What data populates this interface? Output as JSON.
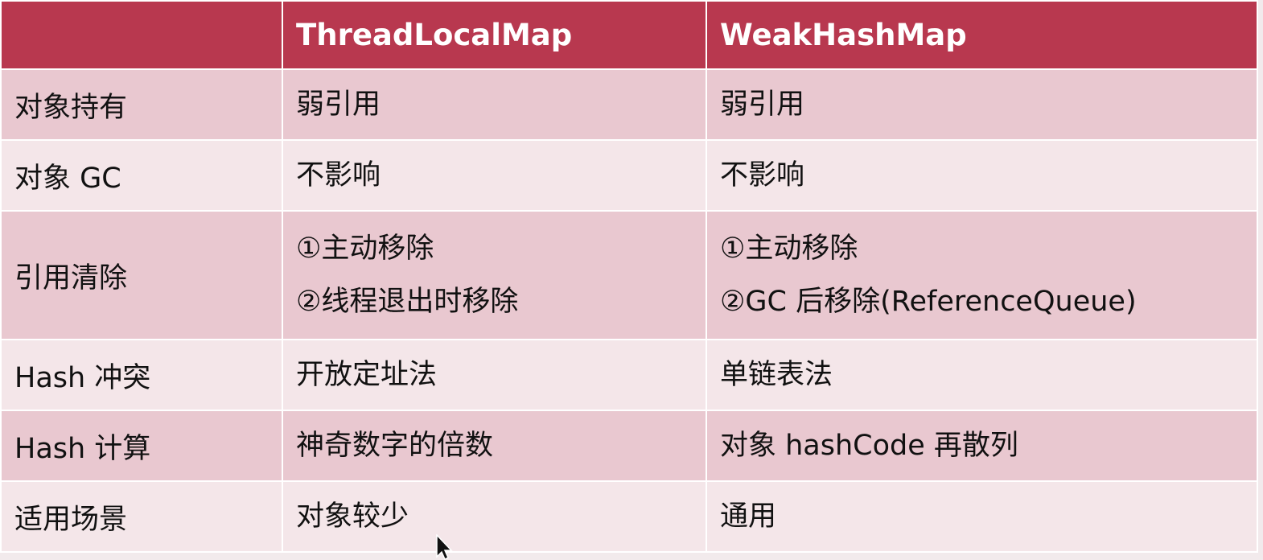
{
  "table": {
    "headers": [
      "",
      "ThreadLocalMap",
      "WeakHashMap"
    ],
    "rows": [
      {
        "label": "对象持有",
        "col1": [
          "弱引用"
        ],
        "col2": [
          "弱引用"
        ]
      },
      {
        "label": "对象 GC",
        "col1": [
          "不影响"
        ],
        "col2": [
          "不影响"
        ]
      },
      {
        "label": "引用清除",
        "col1": [
          "①主动移除",
          "②线程退出时移除"
        ],
        "col2": [
          "①主动移除",
          "②GC 后移除(ReferenceQueue)"
        ]
      },
      {
        "label": "Hash 冲突",
        "col1": [
          "开放定址法"
        ],
        "col2": [
          "单链表法"
        ]
      },
      {
        "label": "Hash 计算",
        "col1": [
          "神奇数字的倍数"
        ],
        "col2": [
          "对象 hashCode 再散列"
        ]
      },
      {
        "label": "适用场景",
        "col1": [
          "对象较少"
        ],
        "col2": [
          "通用"
        ]
      }
    ]
  },
  "colors": {
    "header_bg": "#b8384f",
    "row_dark": "#e9c8d0",
    "row_light": "#f4e6e9",
    "header_text": "#ffffff"
  },
  "icons": {
    "cursor": "mouse-pointer-icon"
  }
}
